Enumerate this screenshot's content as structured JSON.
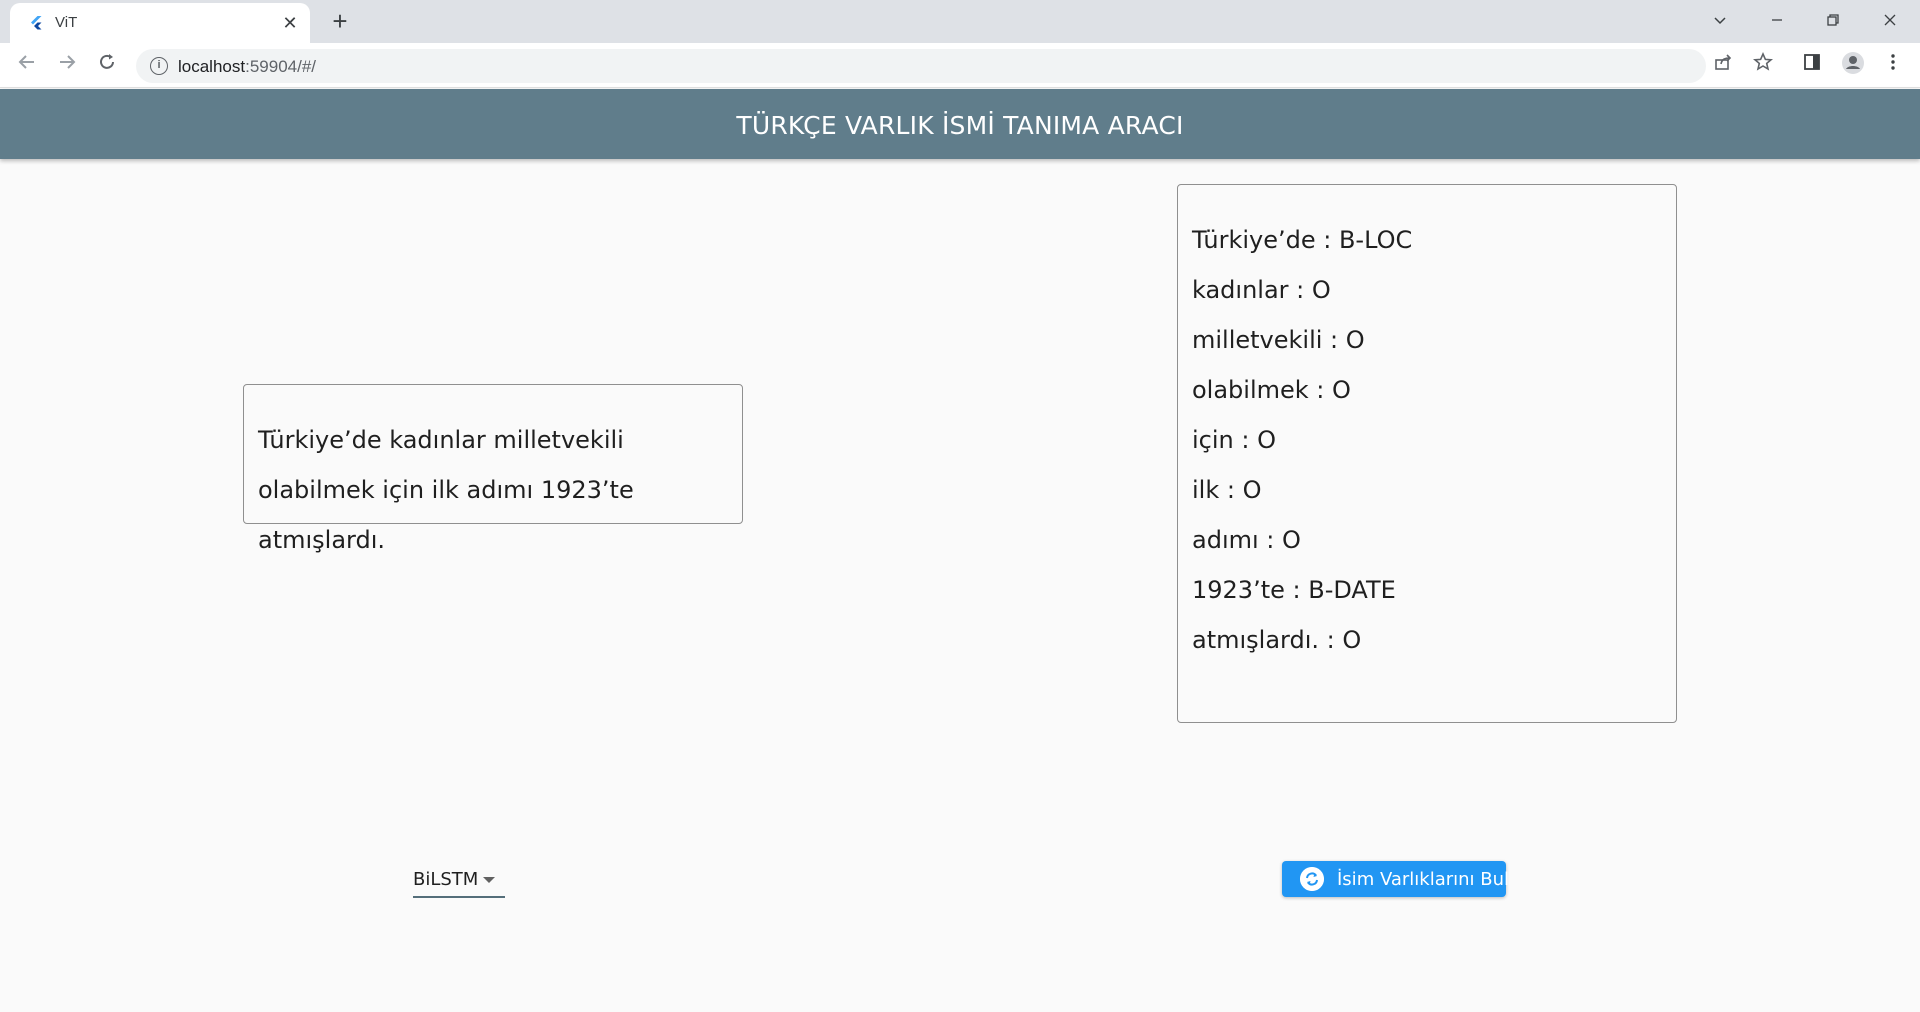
{
  "browser": {
    "tab_title": "ViT",
    "tab_close": "✕",
    "new_tab": "+",
    "url_host": "localhost",
    "url_rest": ":59904/#/"
  },
  "app": {
    "title": "TÜRKÇE VARLIK İSMİ TANIMA ARACI"
  },
  "input": {
    "text": "Türkiye’de kadınlar milletvekili olabilmek için ilk adımı 1923’te atmışlardı."
  },
  "output": {
    "entries": [
      "Türkiye’de : B-LOC",
      "kadınlar : O",
      "milletvekili : O",
      "olabilmek : O",
      "için : O",
      "ilk : O",
      "adımı : O",
      "1923’te : B-DATE",
      "atmışlardı. : O"
    ]
  },
  "model_select": {
    "selected": "BiLSTM"
  },
  "action_button": {
    "label": "İsim Varlıklarını Bul",
    "icon": "sync-icon"
  },
  "colors": {
    "appbar": "#607d8b",
    "button": "#2196f3",
    "background": "#fafafa"
  }
}
